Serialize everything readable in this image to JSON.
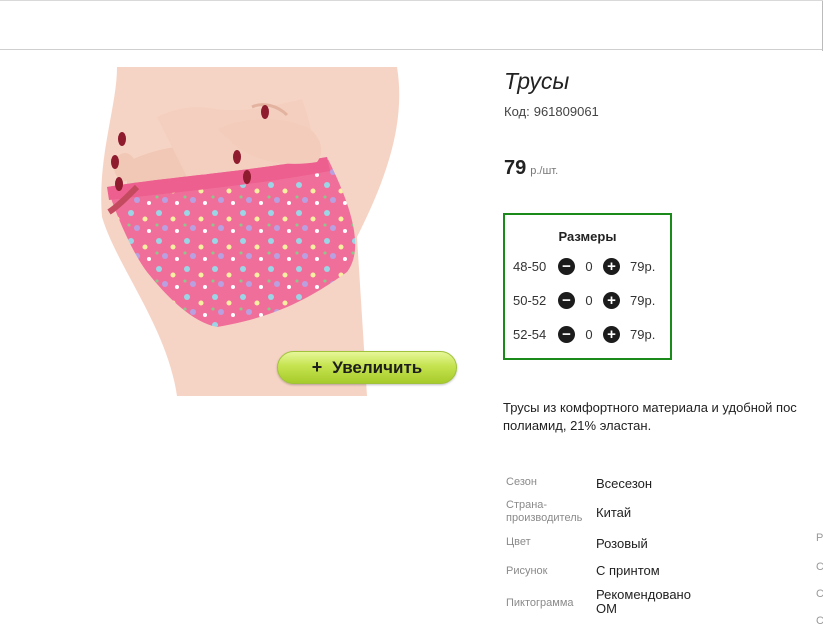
{
  "product": {
    "title": "Трусы",
    "code_label": "Код:",
    "code": "961809061",
    "price": "79",
    "price_unit": "р./шт."
  },
  "zoom_button": {
    "icon": "+",
    "label": "Увеличить"
  },
  "sizes": {
    "title": "Размеры",
    "rows": [
      {
        "size": "48-50",
        "qty": "0",
        "price": "79р."
      },
      {
        "size": "50-52",
        "qty": "0",
        "price": "79р."
      },
      {
        "size": "52-54",
        "qty": "0",
        "price": "79р."
      }
    ]
  },
  "description": {
    "line1": "Трусы из комфортного материала и удобной пос",
    "line2": "полиамид, 21% эластан."
  },
  "specs": [
    {
      "key": "Сезон",
      "value": "Всесезон"
    },
    {
      "key": "Страна-производитель",
      "value": "Китай"
    },
    {
      "key": "Цвет",
      "value": "Розовый"
    },
    {
      "key": "Рисунок",
      "value": "С принтом"
    },
    {
      "key": "Пиктограмма",
      "value": "Рекомендовано ОМ"
    }
  ],
  "edge_chars": [
    "Р",
    "С",
    "С",
    "С"
  ],
  "colors": {
    "accent_green": "#1a8a1a",
    "button_green": "#b9da3f",
    "underwear_pink": "#f06f9a"
  }
}
